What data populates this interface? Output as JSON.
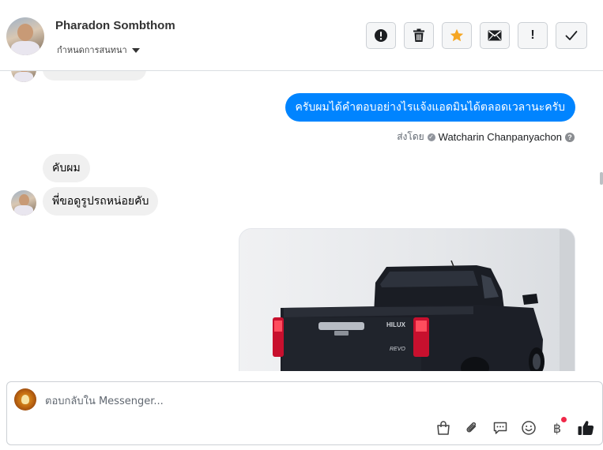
{
  "header": {
    "contact_name": "Pharadon Sombthom",
    "assign_label": "กำหนดการสนทนา",
    "toolbar": [
      {
        "name": "spam-button",
        "icon": "exclamation-circle-icon"
      },
      {
        "name": "delete-button",
        "icon": "trash-icon"
      },
      {
        "name": "star-button",
        "icon": "star-icon"
      },
      {
        "name": "mark-unread-button",
        "icon": "envelope-icon"
      },
      {
        "name": "follow-up-button",
        "icon": "exclamation-icon",
        "label": "!"
      },
      {
        "name": "done-button",
        "icon": "checkmark-icon"
      }
    ]
  },
  "colors": {
    "outgoing_bubble": "#0084ff",
    "incoming_bubble": "#f0f0f0",
    "star": "#f5a623"
  },
  "messages": {
    "outgoing_1": "ครับผมได้คำตอบอย่างไรแจ้งแอดมินได้ตลอดเวลานะครับ",
    "sent_by_label": "ส่งโดย",
    "sent_by_agent": "Watcharin Chanpanyachon",
    "incoming_1": "คับผม",
    "incoming_2": "พี่ขอดูรูปรถหน่อยคับ",
    "photo_badge": "HILUX",
    "photo_sub_badge": "REVO"
  },
  "composer": {
    "placeholder": "ตอบกลับใน Messenger...",
    "icons": [
      "shopping-bag-icon",
      "paperclip-icon",
      "saved-replies-icon",
      "emoji-icon",
      "baht-payment-icon",
      "thumbs-up-icon"
    ]
  }
}
